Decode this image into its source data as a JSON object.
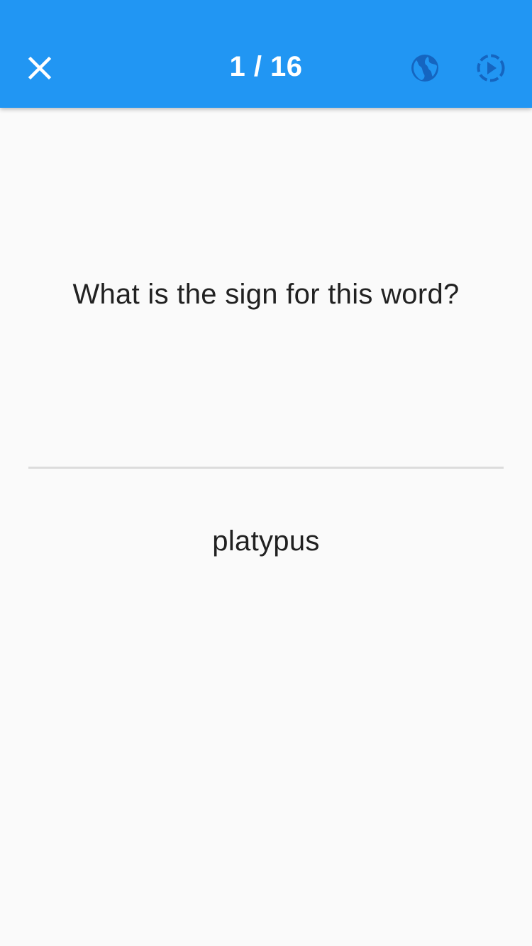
{
  "header": {
    "counter": "1 / 16",
    "background_color": "#2196f3",
    "icons": {
      "close": "close-icon",
      "globe": "globe-icon",
      "play": "play-circle-dashed-icon"
    }
  },
  "card": {
    "prompt": "What is the sign for this word?",
    "word": "platypus"
  }
}
